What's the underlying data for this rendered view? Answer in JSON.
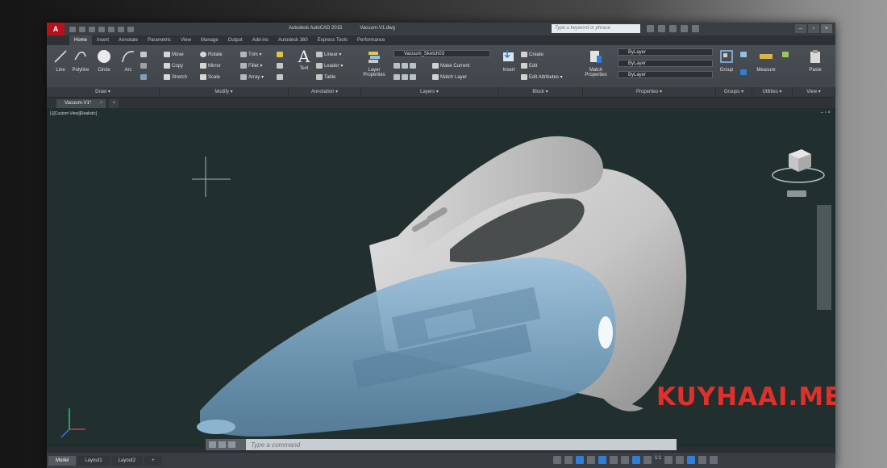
{
  "window": {
    "app_title": "Autodesk AutoCAD 2015",
    "file_title": "Vacuum-V1.dwg",
    "search_placeholder": "Type a keyword or phrase",
    "logo_letter": "A"
  },
  "ribbon_tabs": [
    "Home",
    "Insert",
    "Annotate",
    "Parametric",
    "View",
    "Manage",
    "Output",
    "Add-ins",
    "Autodesk 360",
    "Express Tools",
    "Performance"
  ],
  "ribbon": {
    "draw": {
      "line": "Line",
      "polyline": "Polyline",
      "circle": "Circle",
      "arc": "Arc",
      "panel": "Draw ▾"
    },
    "modify": {
      "move": "Move",
      "rotate": "Rotate",
      "trim": "Trim ▾",
      "copy": "Copy",
      "mirror": "Mirror",
      "fillet": "Fillet ▾",
      "stretch": "Stretch",
      "scale": "Scale",
      "array": "Array ▾",
      "panel": "Modify ▾"
    },
    "annotation": {
      "text": "Text",
      "linear": "Linear ▾",
      "leader": "Leader ▾",
      "table": "Table",
      "panel": "Annotation ▾"
    },
    "layers": {
      "layer_properties": "Layer Properties",
      "current_layer": "Vacuum_Sketch03",
      "make_current": "Make Current",
      "match_layer": "Match Layer",
      "panel": "Layers ▾"
    },
    "block": {
      "insert": "Insert",
      "create": "Create",
      "edit": "Edit",
      "edit_attributes": "Edit Attributes ▾",
      "panel": "Block ▾"
    },
    "properties": {
      "match": "Match Properties",
      "bylayer1": "ByLayer",
      "bylayer2": "ByLayer",
      "bylayer3": "ByLayer",
      "panel": "Properties ▾"
    },
    "groups": {
      "group": "Group",
      "panel": "Groups ▾"
    },
    "utilities": {
      "measure": "Measure",
      "panel": "Utilities ▾"
    },
    "clipboard": {
      "paste": "Paste"
    },
    "view": {
      "panel": "View ▾"
    }
  },
  "file_tabs": {
    "active": "Vacuum-V1*",
    "close": "×",
    "new": "+"
  },
  "viewport": {
    "label": "[-][Custom View][Realistic]",
    "controls": "– ▫ ×",
    "watermark": "KUYHAAI.ME"
  },
  "command_line": {
    "placeholder": "Type a command"
  },
  "status_bar": {
    "tabs": [
      "Model",
      "Layout1",
      "Layout2"
    ],
    "add": "+",
    "scale": "1:1"
  },
  "colors": {
    "viewport_bg": "#21302f",
    "vacuum_body": "#c9c9c9",
    "canister": "#7ea9c8",
    "watermark": "#e0302b",
    "accent_blue": "#2f7fd4"
  }
}
